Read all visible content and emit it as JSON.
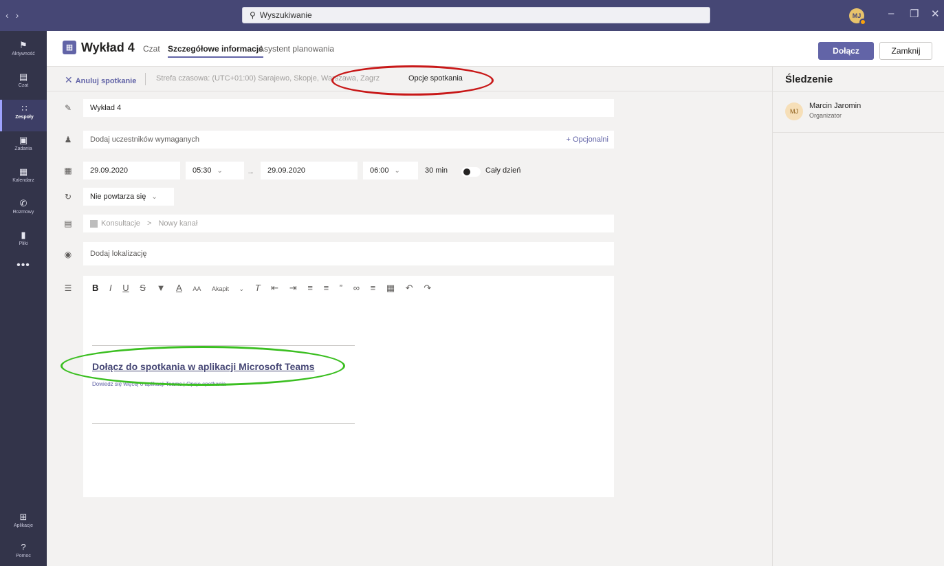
{
  "titlebar": {
    "search_placeholder": "Wyszukiwanie",
    "user_initials": "MJ"
  },
  "rail": {
    "items": [
      {
        "label": "Aktywność",
        "icon": "bell-icon"
      },
      {
        "label": "Czat",
        "icon": "chat-icon"
      },
      {
        "label": "Zespoły",
        "icon": "teams-icon"
      },
      {
        "label": "Zadania",
        "icon": "assignments-icon"
      },
      {
        "label": "Kalendarz",
        "icon": "calendar-icon"
      },
      {
        "label": "Rozmowy",
        "icon": "phone-icon"
      },
      {
        "label": "Pliki",
        "icon": "files-icon"
      }
    ],
    "more": "•••",
    "bottom": [
      {
        "label": "Aplikacje",
        "icon": "apps-icon"
      },
      {
        "label": "Pomoc",
        "icon": "help-icon"
      }
    ],
    "active": "Zespoły"
  },
  "header": {
    "title": "Wykład 4",
    "tabs": [
      {
        "label": "Czat"
      },
      {
        "label": "Szczegółowe informacje"
      },
      {
        "label": "Asystent planowania"
      }
    ],
    "active_tab": "Szczegółowe informacje",
    "join_label": "Dołącz",
    "close_label": "Zamknij"
  },
  "subbar": {
    "cancel_label": "Anuluj spotkanie",
    "timezone": "Strefa czasowa: (UTC+01:00) Sarajewo, Skopje, Warszawa, Zagrzeb",
    "options_label": "Opcje spotkania"
  },
  "form": {
    "title_value": "Wykład 4",
    "attendees_placeholder": "Dodaj uczestników wymaganych",
    "optional_label": "+ Opcjonalni",
    "start_date": "29.09.2020",
    "start_time": "05:30",
    "end_date": "29.09.2020",
    "end_time": "06:00",
    "duration": "30 min",
    "all_day_label": "Cały dzień",
    "all_day_on": false,
    "repeat_value": "Nie powtarza się",
    "channel_team": "Konsultacje",
    "channel_sep": ">",
    "channel_placeholder": "Nowy kanał",
    "location_placeholder": "Dodaj lokalizację"
  },
  "editor": {
    "paragraph_style": "Akapit",
    "join_link_text": "Dołącz do spotkania w aplikacji Microsoft Teams",
    "sub_text": "Dowiedz się więcej o aplikacji Teams | Opcje spotkania"
  },
  "side": {
    "title": "Śledzenie",
    "person_initials": "MJ",
    "person_name": "Marcin Jaromin",
    "person_role": "Organizator"
  },
  "annotations": {
    "red_ring_color": "#c81818",
    "green_ring_color": "#3bbf21"
  }
}
